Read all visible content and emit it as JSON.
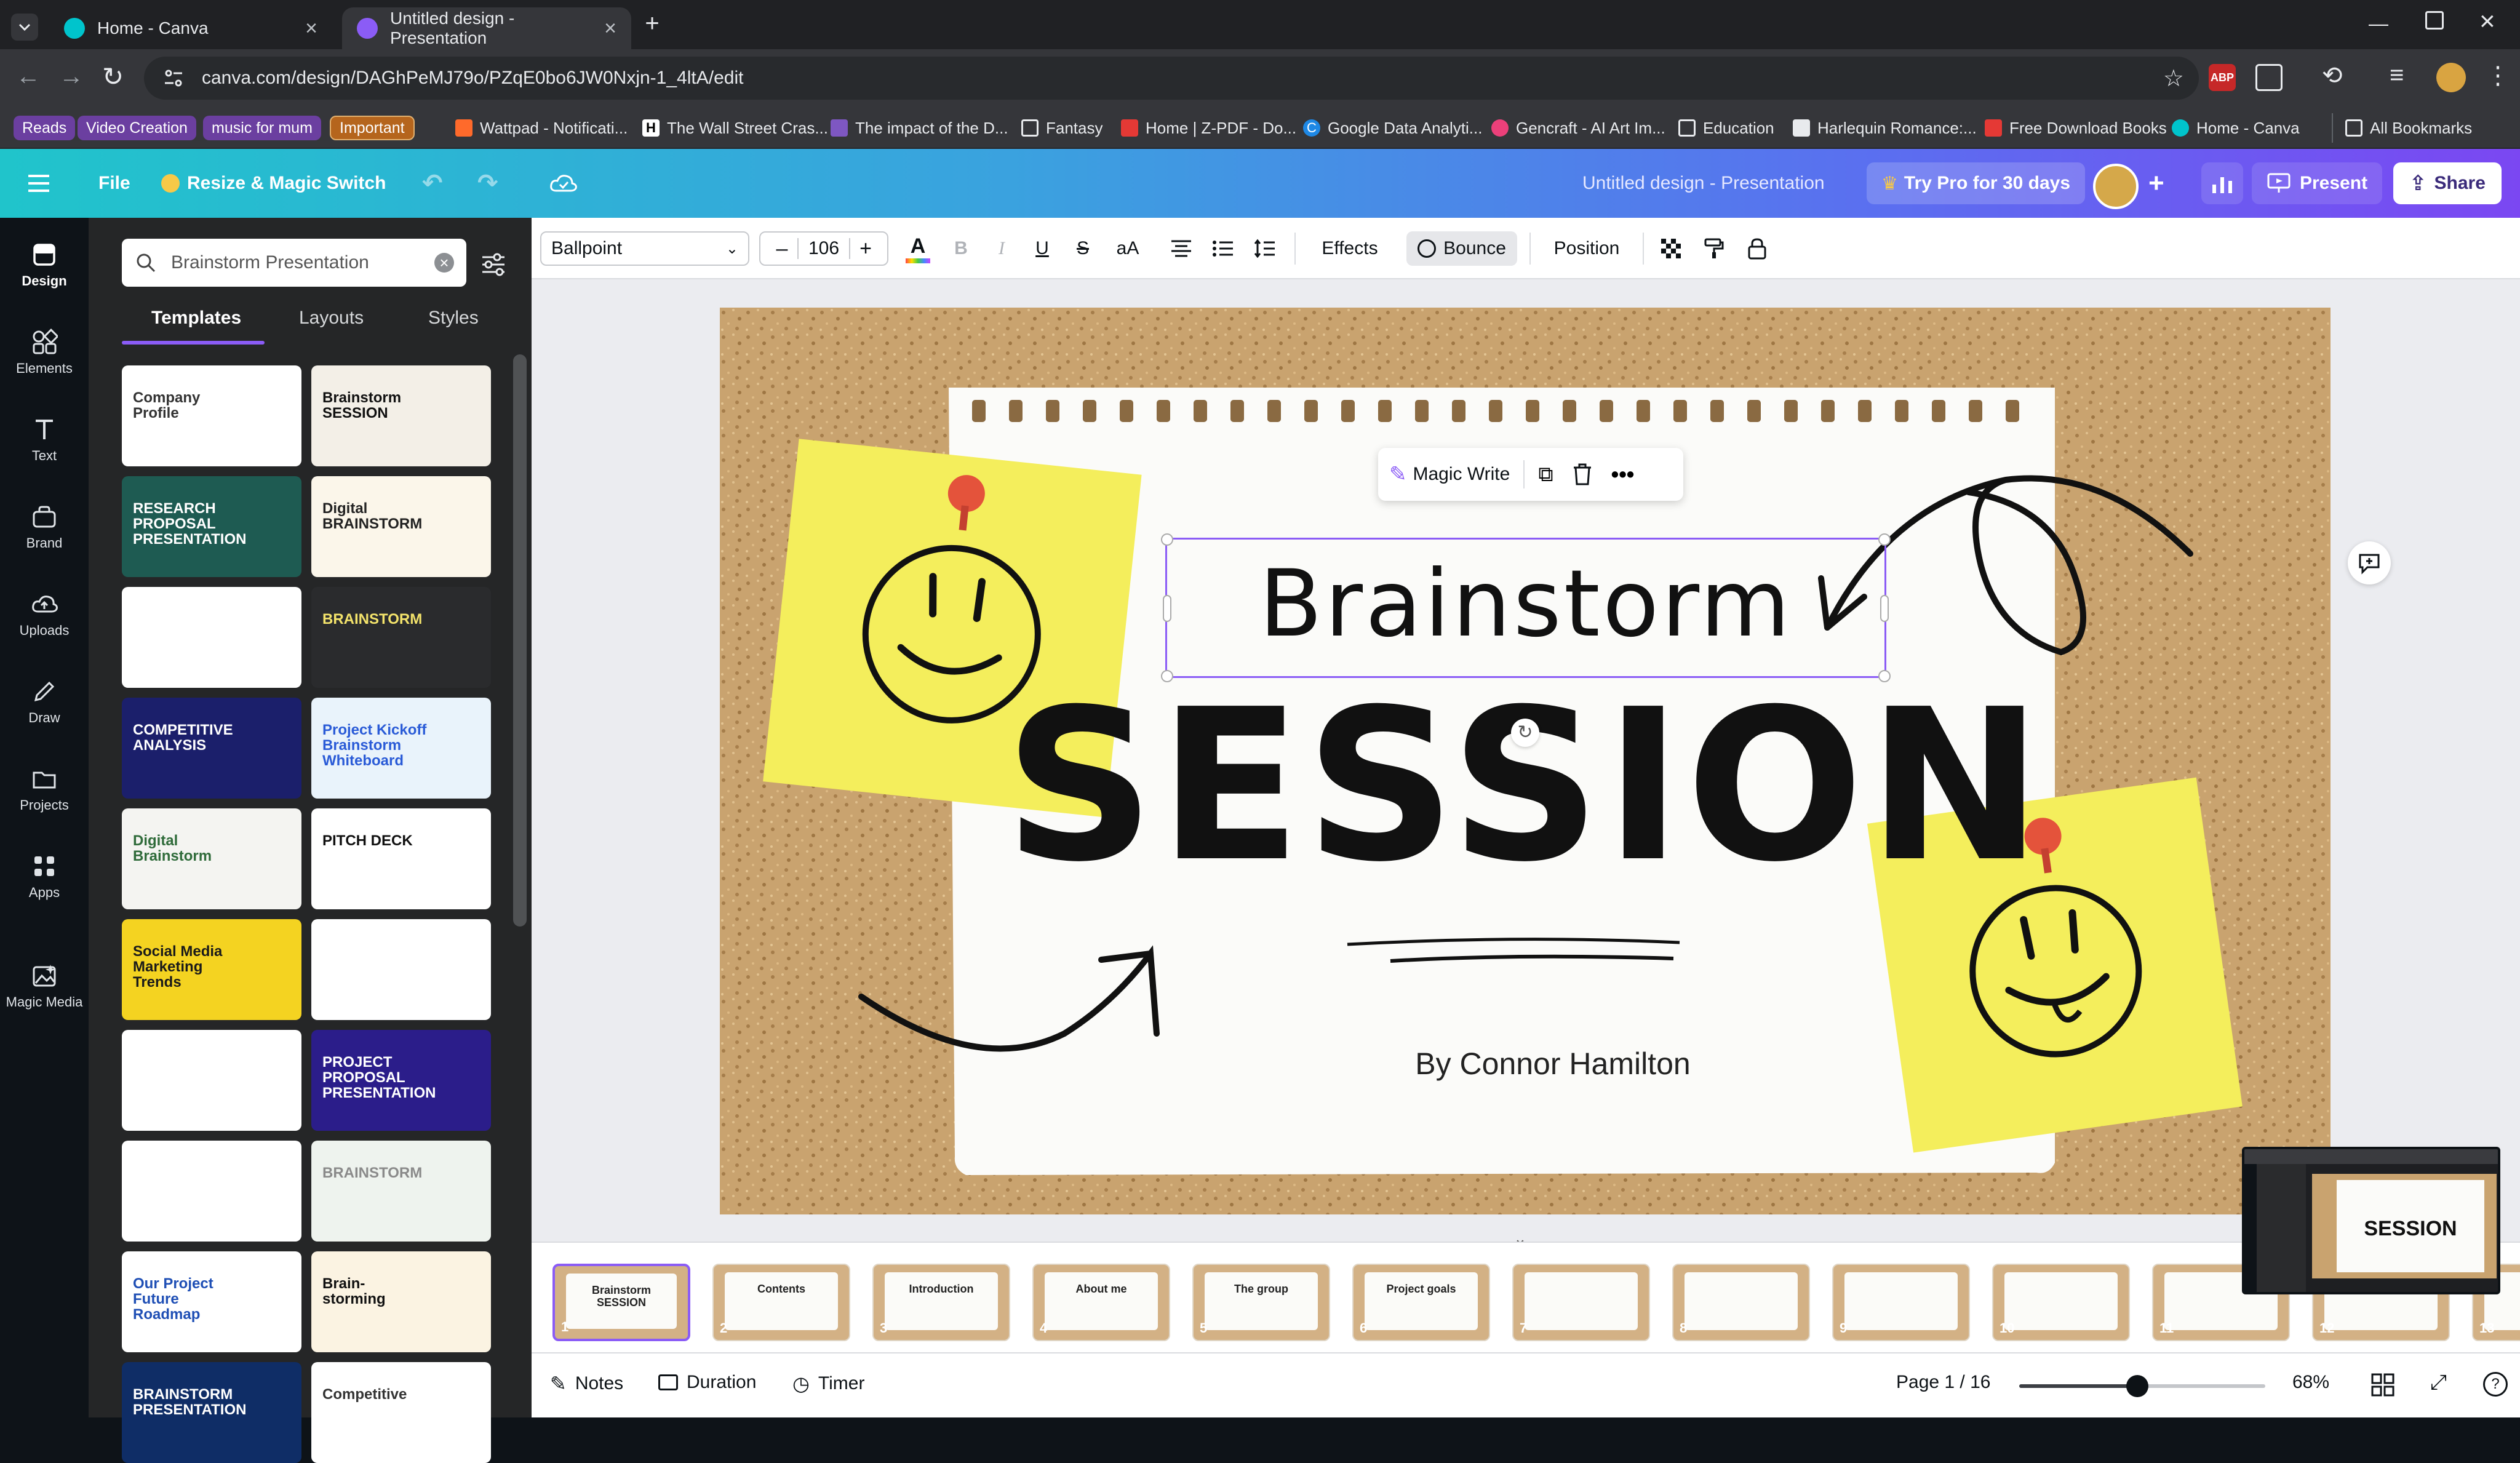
{
  "browser": {
    "tabs": [
      {
        "title": "Home - Canva",
        "active": false
      },
      {
        "title": "Untitled design - Presentation",
        "active": true
      }
    ],
    "url": "canva.com/design/DAGhPeMJ79o/PZqE0bo6JW0Nxjn-1_4ltA/edit",
    "bookmarks": [
      {
        "label": "Reads",
        "color": "#6b3fa0"
      },
      {
        "label": "Video Creation",
        "color": "#6b3fa0"
      },
      {
        "label": "music for mum",
        "color": "#6b3fa0"
      },
      {
        "label": "Important",
        "color": "#b5651d"
      },
      {
        "label": "Wattpad - Notificati..."
      },
      {
        "label": "The Wall Street Cras..."
      },
      {
        "label": "The impact of the D..."
      },
      {
        "label": "Fantasy"
      },
      {
        "label": "Home | Z-PDF - Do..."
      },
      {
        "label": "Google Data Analyti..."
      },
      {
        "label": "Gencraft - AI Art Im..."
      },
      {
        "label": "Education"
      },
      {
        "label": "Harlequin Romance:..."
      },
      {
        "label": "Free Download Books"
      },
      {
        "label": "Home - Canva"
      },
      {
        "label": "All Bookmarks"
      }
    ]
  },
  "header": {
    "file_label": "File",
    "resize_label": "Resize & Magic Switch",
    "design_title": "Untitled design - Presentation",
    "pro_label": "Try Pro for 30 days",
    "present_label": "Present",
    "share_label": "Share"
  },
  "rail": [
    {
      "label": "Design",
      "icon": "design-icon"
    },
    {
      "label": "Elements",
      "icon": "elements-icon"
    },
    {
      "label": "Text",
      "icon": "text-icon"
    },
    {
      "label": "Brand",
      "icon": "brand-icon"
    },
    {
      "label": "Uploads",
      "icon": "uploads-icon"
    },
    {
      "label": "Draw",
      "icon": "draw-icon"
    },
    {
      "label": "Projects",
      "icon": "projects-icon"
    },
    {
      "label": "Apps",
      "icon": "apps-icon"
    },
    {
      "label": "Magic Media",
      "icon": "magic-media-icon"
    }
  ],
  "panel": {
    "search_value": "Brainstorm Presentation",
    "tabs": [
      "Templates",
      "Layouts",
      "Styles"
    ],
    "templates": [
      {
        "title": "Company\nProfile",
        "bg": "#ffffff",
        "fg": "#333333"
      },
      {
        "title": "Brainstorm\nSESSION",
        "bg": "#f3efe7",
        "fg": "#111111"
      },
      {
        "title": "RESEARCH\nPROPOSAL\nPRESENTATION",
        "bg": "#1e5b52",
        "fg": "#ffffff"
      },
      {
        "title": "Digital\nBRAINSTORM",
        "bg": "#fbf6ea",
        "fg": "#222222"
      },
      {
        "title": "",
        "bg": "#ffffff",
        "fg": "#333333"
      },
      {
        "title": "BRAINSTORM",
        "bg": "#2a2b2d",
        "fg": "#f3e36b"
      },
      {
        "title": "COMPETITIVE\nANALYSIS",
        "bg": "#1b1f6b",
        "fg": "#ffffff"
      },
      {
        "title": "Project Kickoff\nBrainstorm\nWhiteboard",
        "bg": "#e9f3fb",
        "fg": "#2a5bd7"
      },
      {
        "title": "Digital\nBrainstorm",
        "bg": "#f4f4f1",
        "fg": "#2f6b3a"
      },
      {
        "title": "PITCH DECK",
        "bg": "#ffffff",
        "fg": "#111111"
      },
      {
        "title": "Social Media\nMarketing\nTrends",
        "bg": "#f4d321",
        "fg": "#1a1a1a"
      },
      {
        "title": "",
        "bg": "#ffffff",
        "fg": "#333333"
      },
      {
        "title": "",
        "bg": "#ffffff",
        "fg": "#333333"
      },
      {
        "title": "PROJECT\nPROPOSAL\nPRESENTATION",
        "bg": "#2b1d8a",
        "fg": "#ffffff"
      },
      {
        "title": "",
        "bg": "#ffffff",
        "fg": "#333333"
      },
      {
        "title": "BRAINSTORM",
        "bg": "#eef3ee",
        "fg": "#8a8a8a"
      },
      {
        "title": "Our Project\nFuture\nRoadmap",
        "bg": "#ffffff",
        "fg": "#1f4fb5"
      },
      {
        "title": "Brain-\nstorming",
        "bg": "#fbf3e2",
        "fg": "#111111"
      },
      {
        "title": "BRAINSTORM\nPRESENTATION",
        "bg": "#0f2d66",
        "fg": "#ffffff"
      },
      {
        "title": "Competitive",
        "bg": "#ffffff",
        "fg": "#333333"
      }
    ]
  },
  "toolbar": {
    "font": "Ballpoint",
    "size": "106",
    "effects": "Effects",
    "bounce": "Bounce",
    "position": "Position"
  },
  "canvas": {
    "magic_write": "Magic Write",
    "title_line1": "Brainstorm",
    "title_line2": "SESSION",
    "author": "By Connor Hamilton"
  },
  "filmstrip": {
    "slides": [
      {
        "num": "1",
        "label": "Brainstorm\nSESSION"
      },
      {
        "num": "2",
        "label": "Contents"
      },
      {
        "num": "3",
        "label": "Introduction"
      },
      {
        "num": "4",
        "label": "About me"
      },
      {
        "num": "5",
        "label": "The group"
      },
      {
        "num": "6",
        "label": "Project goals"
      },
      {
        "num": "7",
        "label": ""
      },
      {
        "num": "8",
        "label": ""
      },
      {
        "num": "9",
        "label": ""
      },
      {
        "num": "10",
        "label": ""
      },
      {
        "num": "11",
        "label": ""
      },
      {
        "num": "12",
        "label": ""
      },
      {
        "num": "13",
        "label": ""
      }
    ]
  },
  "footer": {
    "notes": "Notes",
    "duration": "Duration",
    "timer": "Timer",
    "page": "Page 1 / 16",
    "zoom": "68%",
    "zoom_level": 0.48
  }
}
